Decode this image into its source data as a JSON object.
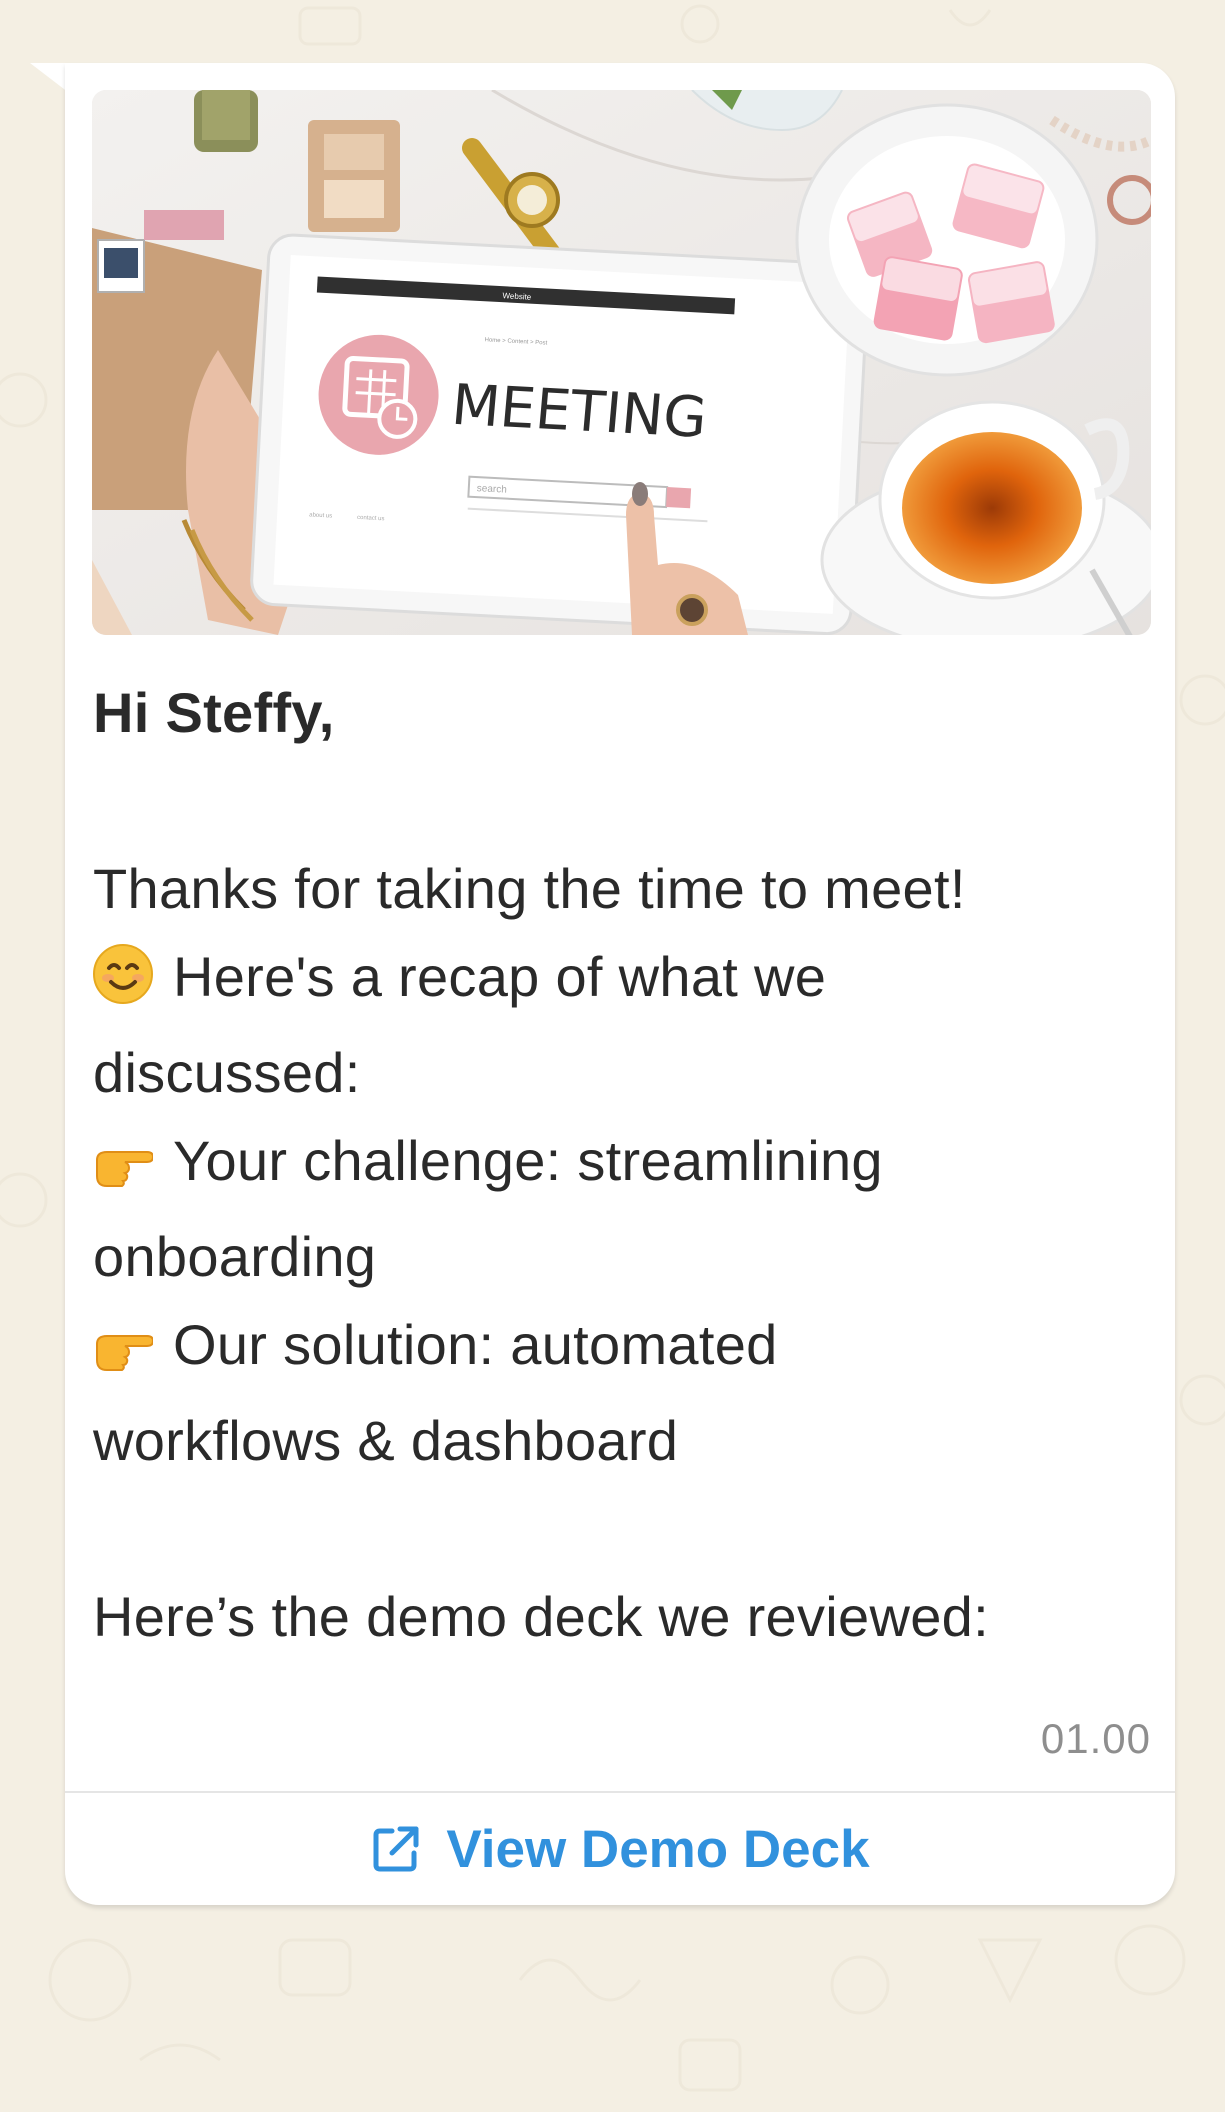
{
  "message": {
    "greeting": "Hi Steffy,",
    "line1": "Thanks for taking the time to meet!",
    "line2": "Here's a recap of what we",
    "line3": "discussed:",
    "line4": "Your challenge: streamlining",
    "line5": "onboarding",
    "line6": "Our solution: automated",
    "line7": "workflows & dashboard",
    "line8": "Here’s the demo deck we reviewed:",
    "timestamp": "01.00"
  },
  "media": {
    "tablet_header": "Website",
    "tablet_breadcrumb": "Home > Content > Post",
    "tablet_title": "MEETING",
    "tablet_search_placeholder": "search",
    "tablet_footer_left": "about us",
    "tablet_footer_right": "contact us"
  },
  "cta": {
    "label": "View Demo Deck",
    "icon": "external-link-icon",
    "color": "#3191dd"
  },
  "icons": {
    "smile": "smiling-face-icon",
    "point": "pointing-right-icon"
  },
  "colors": {
    "background": "#f4efe3",
    "bubble": "#ffffff",
    "text": "#2a2a2a",
    "timestamp": "#8e8e8e"
  }
}
